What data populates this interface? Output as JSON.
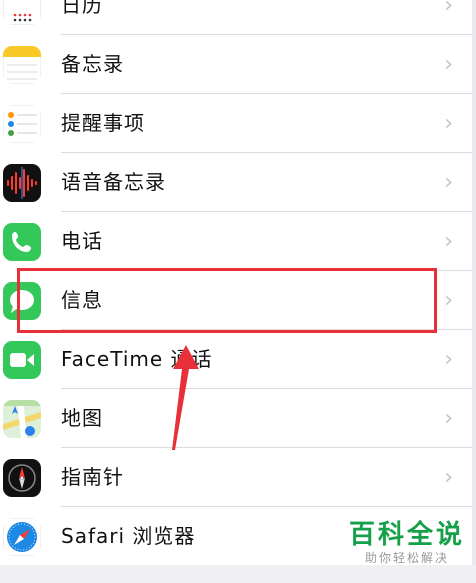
{
  "settings_list": {
    "items": [
      {
        "label": "日历",
        "icon": "calendar-icon"
      },
      {
        "label": "备忘录",
        "icon": "notes-icon"
      },
      {
        "label": "提醒事项",
        "icon": "reminders-icon"
      },
      {
        "label": "语音备忘录",
        "icon": "voice-memos-icon"
      },
      {
        "label": "电话",
        "icon": "phone-icon"
      },
      {
        "label": "信息",
        "icon": "messages-icon"
      },
      {
        "label": "FaceTime 通话",
        "icon": "facetime-icon"
      },
      {
        "label": "地图",
        "icon": "maps-icon"
      },
      {
        "label": "指南针",
        "icon": "compass-icon"
      },
      {
        "label": "Safari 浏览器",
        "icon": "safari-icon"
      }
    ],
    "chevron": "›"
  },
  "annotation": {
    "highlight_color": "#e8303a",
    "highlighted_item": "信息"
  },
  "watermark": {
    "title": "百科全说",
    "subtitle": "助你轻松解决"
  }
}
